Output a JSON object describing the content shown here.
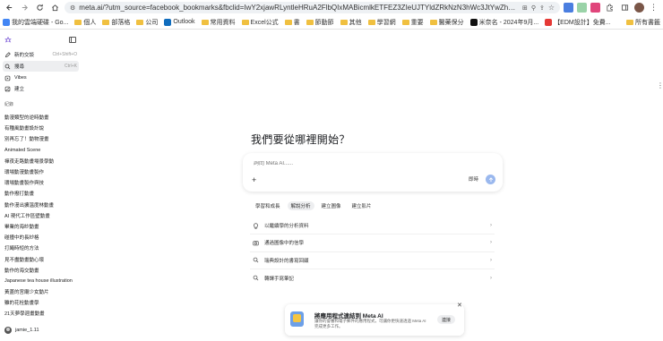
{
  "browser": {
    "url": "meta.ai/?utm_source=facebook_bookmarks&fbclid=IwY2xjawRLyntleHRuA2FlbQIxMABicmlkETFEZ3ZIeUJTYldZRkNzN3hWc3JtYwZhcHBfaWQQMjIyMDM5M..."
  },
  "bookmarks": [
    {
      "label": "我的雲端硬碟 - Go...",
      "color": "#4285f4"
    },
    {
      "label": "個人",
      "color": "folder"
    },
    {
      "label": "部落格",
      "color": "folder"
    },
    {
      "label": "公司",
      "color": "folder"
    },
    {
      "label": "Outlook",
      "color": "#0f6cbd"
    },
    {
      "label": "常用資料",
      "color": "folder"
    },
    {
      "label": "Excel公式",
      "color": "folder"
    },
    {
      "label": "書",
      "color": "folder"
    },
    {
      "label": "節動節",
      "color": "folder"
    },
    {
      "label": "其他",
      "color": "folder"
    },
    {
      "label": "學習網",
      "color": "folder"
    },
    {
      "label": "重要",
      "color": "folder"
    },
    {
      "label": "醫藥保分",
      "color": "folder"
    },
    {
      "label": "米奈名 - 2024年9月...",
      "color": "#111111"
    },
    {
      "label": "【EDM設計】免費...",
      "color": "#e53935"
    }
  ],
  "bookmarks_end": "所有書籤",
  "sidebar": {
    "items": [
      {
        "label": "新的交談",
        "shortcut": "Ctrl+Shift+O",
        "icon": "edit-icon"
      },
      {
        "label": "搜尋",
        "shortcut": "Ctrl+K",
        "icon": "search-icon"
      },
      {
        "label": "Vibes",
        "shortcut": "",
        "icon": "vibes-icon"
      },
      {
        "label": "建立",
        "shortcut": "",
        "icon": "create-icon"
      }
    ],
    "history_label": "紀錄",
    "history": [
      "動漫類型的逆時動畫",
      "有種風動畫設計說",
      "別再忘了！動物漫畫",
      "Animated Scene",
      "禪夜走路動畫場景學動",
      "環場動漫動畫製作",
      "環場動畫製作與技",
      "動作撥打動畫",
      "動作漫出擴溫度林動畫",
      "AI 現代工作區壁動畫",
      "畢業的海紗動畫",
      "碰撞中的長紗格",
      "打繩時短的方法",
      "見不盡動畫動心壞",
      "動作的海交動畫",
      "Japanese tea house illustration",
      "黃蓋的宮廟少女動片",
      "雖的花栓動畫學",
      "21天夢學週畫動畫"
    ],
    "user_name": "jamie_1.11"
  },
  "main": {
    "heading": "我們要從哪裡開始？",
    "composer_placeholder": "詢問 Meta AI......",
    "tool_label": "即時",
    "chips": [
      "學習和成長",
      "解說分析",
      "建立圖像",
      "建立影片"
    ],
    "active_chip_index": 1,
    "suggestions": [
      {
        "label": "以繼續學的分析資料",
        "icon": "bulb-icon"
      },
      {
        "label": "通過圖像中的信學",
        "icon": "camera-icon"
      },
      {
        "label": "瑞典設計的書寫回顧",
        "icon": "search-icon"
      },
      {
        "label": "轉譯手寫筆記",
        "icon": "search-icon"
      }
    ]
  },
  "banner": {
    "title": "將應用程式連結到 Meta AI",
    "description": "讓你的會審和電子郵件的應用程式，可讓你更快速透過 Meta AI 完成更多工作。",
    "button": "連接"
  }
}
